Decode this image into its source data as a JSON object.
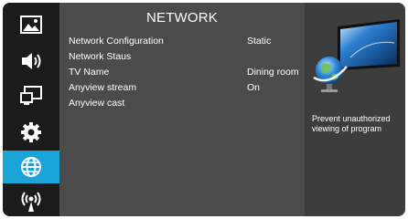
{
  "sidebar": {
    "items": [
      {
        "name": "picture",
        "icon": "image-icon"
      },
      {
        "name": "sound",
        "icon": "speaker-icon"
      },
      {
        "name": "channel",
        "icon": "screens-icon"
      },
      {
        "name": "settings",
        "icon": "gear-icon"
      },
      {
        "name": "network",
        "icon": "globe-icon",
        "active": true
      },
      {
        "name": "wireless",
        "icon": "broadcast-icon"
      }
    ]
  },
  "main": {
    "title": "NETWORK",
    "rows": [
      {
        "label": "Network Configuration",
        "value": "Static"
      },
      {
        "label": "Network Staus",
        "value": ""
      },
      {
        "label": "TV Name",
        "value": "Dining room"
      },
      {
        "label": "Anyview stream",
        "value": "On"
      },
      {
        "label": "Anyview  cast",
        "value": ""
      }
    ]
  },
  "info": {
    "illustration": "tv-globe-illustration",
    "description": "Prevent unauthorized viewing of program"
  },
  "colors": {
    "accent": "#1ba4d7",
    "sidebar_bg": "#1b1b1b",
    "menu_bg": "#4b4b4b",
    "info_bg": "#3d3d3d"
  }
}
